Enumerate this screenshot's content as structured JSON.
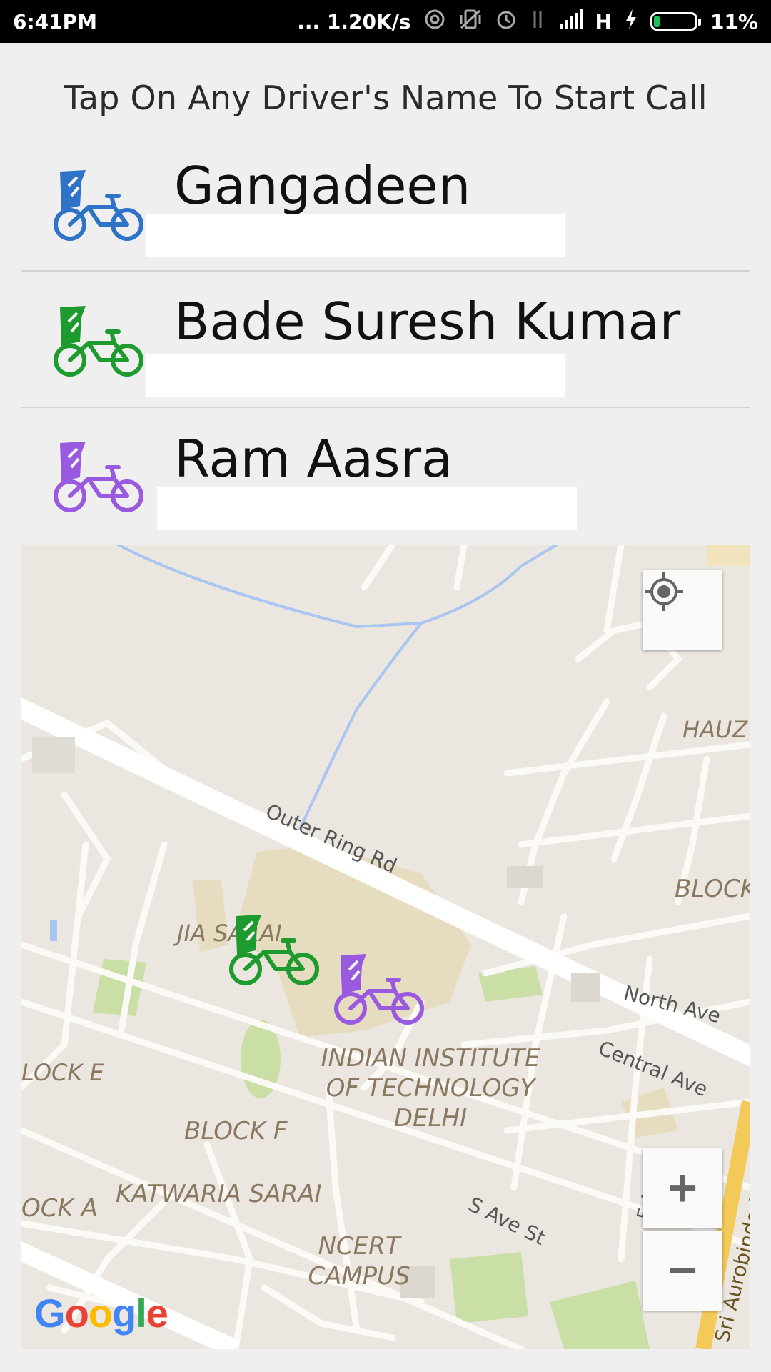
{
  "status_bar": {
    "time": "6:41PM",
    "speed": "... 1.20K/s",
    "network": "H",
    "battery": "11%",
    "icons": [
      "hotspot-icon",
      "vibrate-icon",
      "alarm-icon",
      "data-icon",
      "signal-icon",
      "charging-icon",
      "battery-icon"
    ]
  },
  "instruction": "Tap On Any Driver's Name To Start Call",
  "drivers": [
    {
      "name": "Gangadeen",
      "icon": "rickshaw-icon",
      "color": "#2f73c9"
    },
    {
      "name": "Bade Suresh Kumar",
      "icon": "rickshaw-icon",
      "color": "#1e9b2e"
    },
    {
      "name": "Ram Aasra",
      "icon": "rickshaw-icon",
      "color": "#9a5ae0"
    }
  ],
  "map": {
    "labels": {
      "road_outer": "Outer Ring Rd",
      "hauz": "HAUZ K",
      "block_right": "BLOCK",
      "jia_sarai": "JIA SARAI",
      "north_ave": "North Ave",
      "central_ave": "Central Ave",
      "block_e": "LOCK E",
      "iit_line1": "INDIAN INSTITUTE",
      "iit_line2": "OF TECHNOLOGY",
      "iit_line3": "DELHI",
      "block_f": "BLOCK F",
      "katwaria": "KATWARIA SARAI",
      "block_a": "OCK A",
      "s_ave": "S Ave St",
      "e_ave": "E Ave St",
      "aurobindo": "Sri Aurobindo Marg",
      "ncert_line1": "NCERT",
      "ncert_line2": "CAMPUS"
    },
    "controls": {
      "locate": "my-location-icon",
      "zoom_in": "+",
      "zoom_out": "−"
    },
    "logo": "Google"
  }
}
